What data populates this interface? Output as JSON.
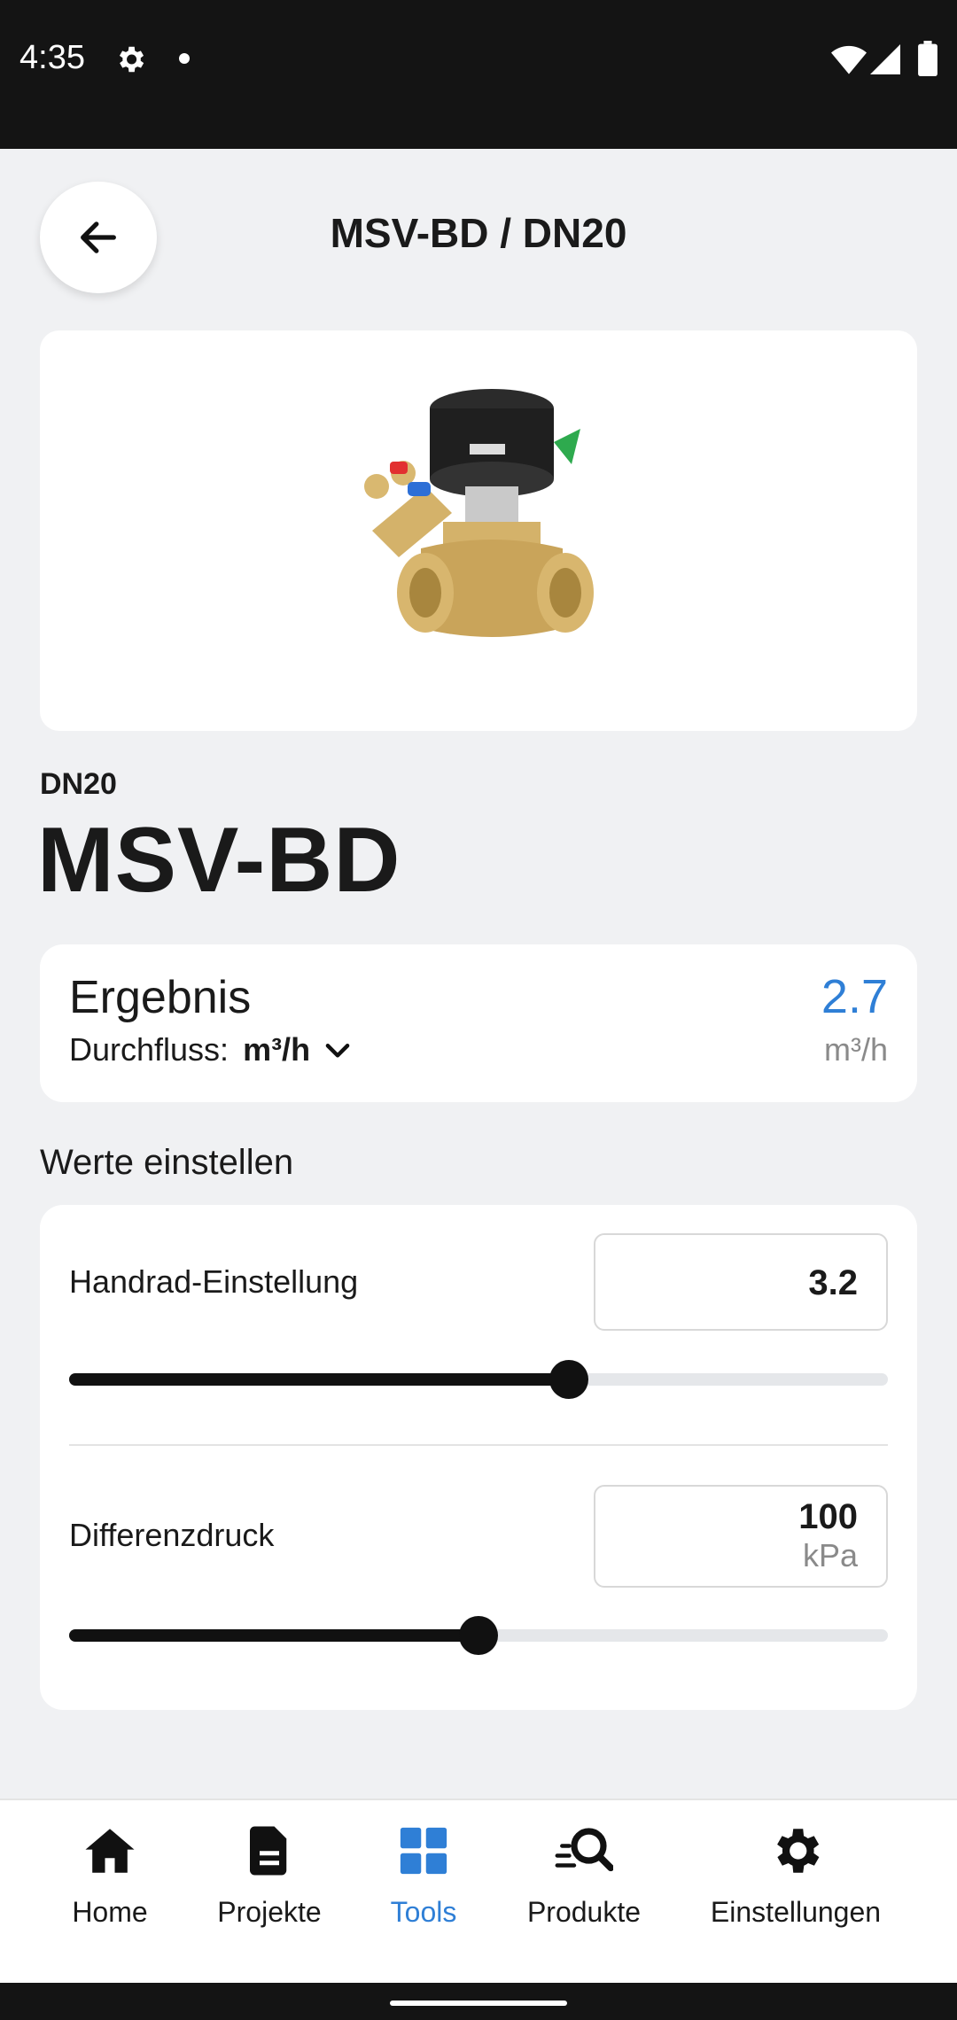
{
  "status_bar": {
    "time": "4:35",
    "icons": [
      "gear-icon",
      "notification-dot",
      "wifi-icon",
      "signal-icon",
      "battery-icon"
    ]
  },
  "header": {
    "back_icon": "arrow-left-icon",
    "title": "MSV-BD / DN20"
  },
  "product": {
    "image": "valve-image",
    "size": "DN20",
    "name": "MSV-BD"
  },
  "result": {
    "title": "Ergebnis",
    "flow_label": "Durchfluss:",
    "flow_unit": "m³/h",
    "value": "2.7",
    "value_unit": "m³/h"
  },
  "settings": {
    "section_title": "Werte einstellen",
    "handwheel": {
      "label": "Handrad-Einstellung",
      "value": "3.2",
      "slider_fraction": 0.61
    },
    "pressure": {
      "label": "Differenzdruck",
      "value": "100",
      "unit": "kPa",
      "slider_fraction": 0.5
    }
  },
  "nav": {
    "items": [
      {
        "label": "Home",
        "icon": "home-icon"
      },
      {
        "label": "Projekte",
        "icon": "document-icon"
      },
      {
        "label": "Tools",
        "icon": "grid-icon",
        "active": true
      },
      {
        "label": "Produkte",
        "icon": "search-icon"
      },
      {
        "label": "Einstellungen",
        "icon": "gear-icon"
      }
    ]
  },
  "colors": {
    "accent": "#2f7fd6",
    "background": "#f0f1f3",
    "status_bar": "#141414"
  }
}
